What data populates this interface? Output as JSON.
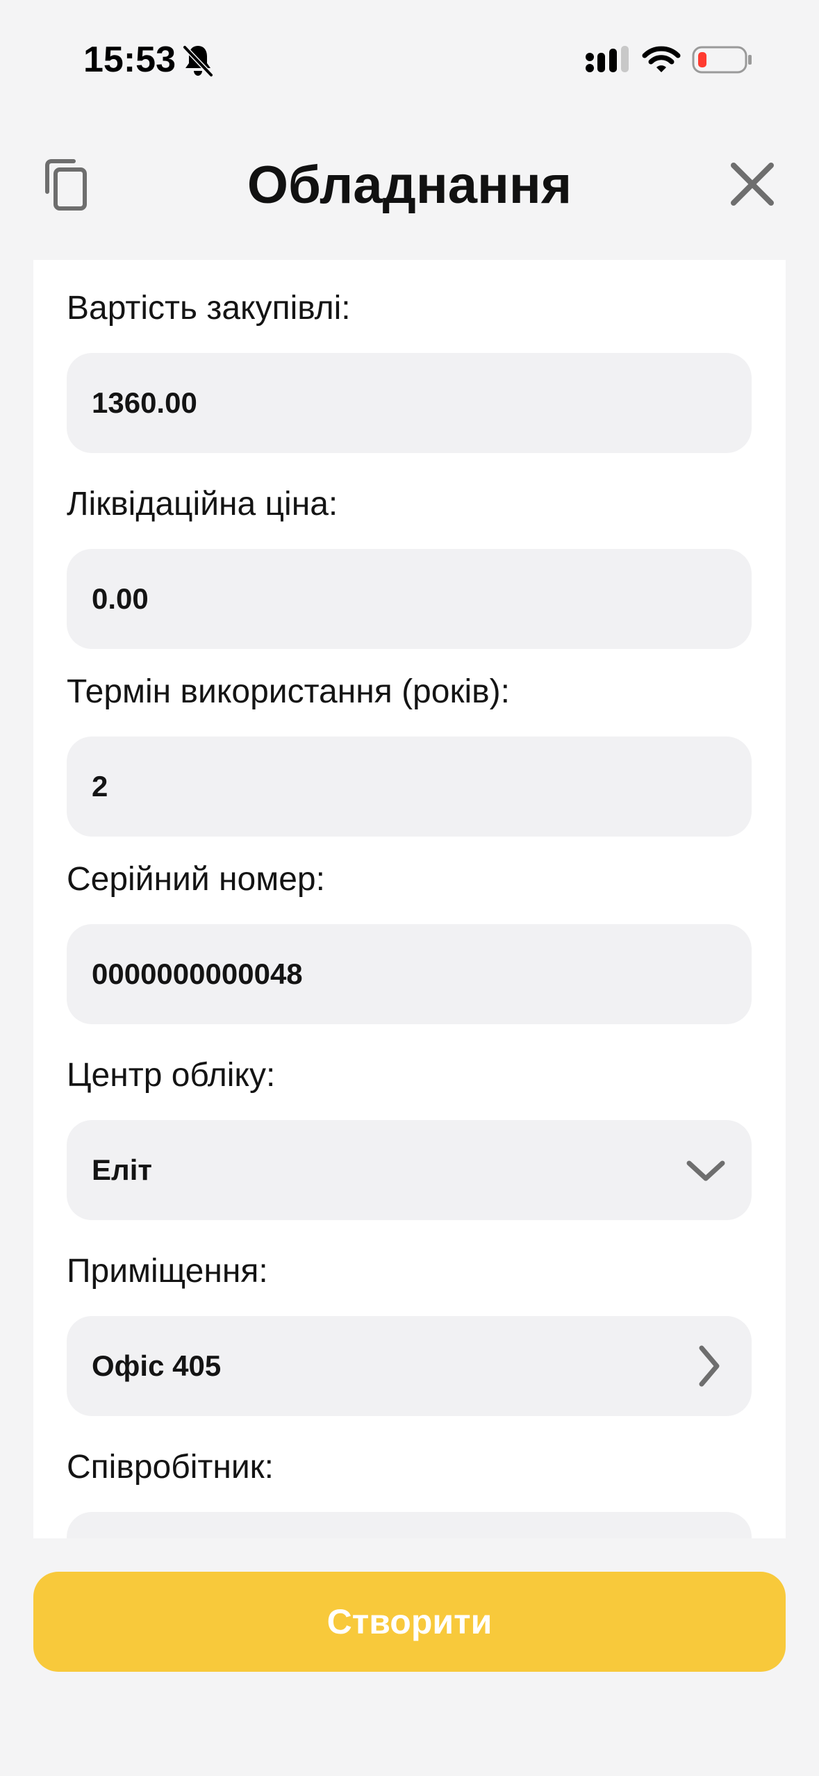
{
  "status_bar": {
    "time": "15:53",
    "icons": [
      "bell-slash-icon",
      "signal-icon",
      "wifi-icon",
      "battery-low-icon"
    ],
    "battery_color": "#ff3b30"
  },
  "header": {
    "title": "Обладнання",
    "left_icon": "copy-icon",
    "right_icon": "close-icon"
  },
  "form": {
    "fields": [
      {
        "label": "Вартість закупівлі:",
        "value": "1360.00",
        "type": "text"
      },
      {
        "label": "Ліквідаційна ціна:",
        "value": "0.00",
        "type": "text"
      },
      {
        "label": "Термін використання (років):",
        "value": "2",
        "type": "text"
      },
      {
        "label": "Серійний номер:",
        "value": "0000000000048",
        "type": "text"
      },
      {
        "label": "Центр обліку:",
        "value": "Еліт",
        "type": "dropdown",
        "icon": "chevron-down-icon"
      },
      {
        "label": "Приміщення:",
        "value": "Офіс 405",
        "type": "navigation",
        "icon": "chevron-right-icon"
      },
      {
        "label": "Співробітник:",
        "value": "",
        "type": "text"
      }
    ]
  },
  "actions": {
    "create_label": "Створити"
  },
  "colors": {
    "background": "#f4f4f5",
    "card": "#ffffff",
    "input_bg": "#f1f1f3",
    "accent": "#f8c93b",
    "icon_gray": "#6e6e6e"
  }
}
